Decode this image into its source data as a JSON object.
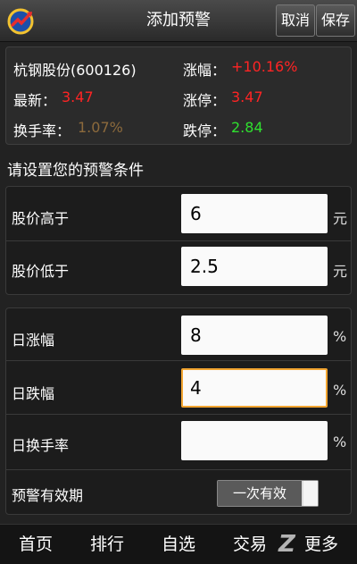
{
  "header": {
    "title": "添加预警",
    "cancel_label": "取消",
    "save_label": "保存"
  },
  "stock": {
    "name": "杭钢股份(600126)",
    "change_label": "涨幅：",
    "change_value": "+10.16%",
    "latest_label": "最新：",
    "latest_value": "3.47",
    "limit_up_label": "涨停：",
    "limit_up_value": "3.47",
    "turnover_label": "换手率：",
    "turnover_value": "1.07%",
    "limit_down_label": "跌停：",
    "limit_down_value": "2.84"
  },
  "form": {
    "section_title": "请设置您的预警条件",
    "price_high": {
      "label": "股价高于",
      "value": "6",
      "unit": "元"
    },
    "price_low": {
      "label": "股价低于",
      "value": "2.5",
      "unit": "元"
    },
    "daily_rise": {
      "label": "日涨幅",
      "value": "8",
      "unit": "%"
    },
    "daily_fall": {
      "label": "日跌幅",
      "value": "4",
      "unit": "%"
    },
    "daily_turnover": {
      "label": "日换手率",
      "value": "",
      "unit": "%"
    },
    "validity": {
      "label": "预警有效期",
      "value": "一次有效"
    }
  },
  "nav": {
    "home": "首页",
    "ranking": "排行",
    "watchlist": "自选",
    "trade": "交易",
    "more": "更多"
  },
  "colors": {
    "up": "#ff2424",
    "down": "#2fe02f",
    "turnover": "#8c6a3c",
    "focus": "#f2a531"
  }
}
